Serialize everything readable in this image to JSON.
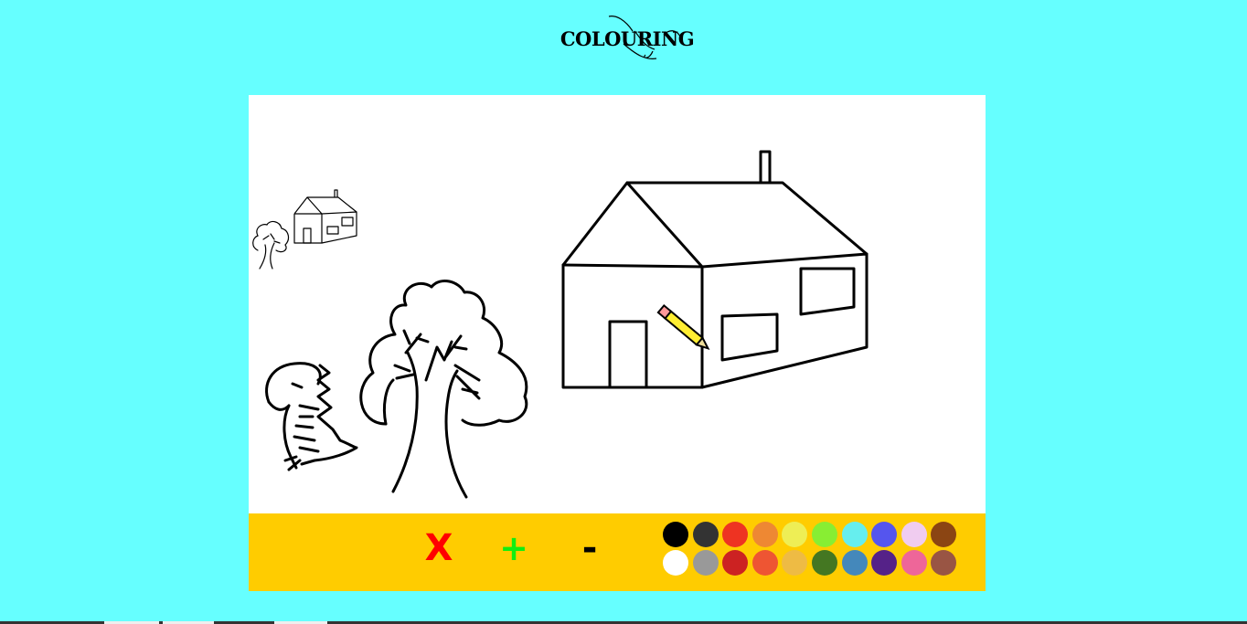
{
  "app": {
    "title": "COLOURING"
  },
  "thumbnails": [
    {
      "name": "tree"
    },
    {
      "name": "house"
    }
  ],
  "toolbar": {
    "clear_label": "X",
    "zoom_in_label": "+",
    "zoom_out_label": "-"
  },
  "palette": {
    "colors": [
      "#000000",
      "#333333",
      "#ee3322",
      "#ee8833",
      "#eeee55",
      "#88ee33",
      "#66eeee",
      "#5555ee",
      "#f0ccf0",
      "#8b4513",
      "#ffffff",
      "#999999",
      "#cc2222",
      "#ee5533",
      "#eebb44",
      "#447722",
      "#4488bb",
      "#552288",
      "#ee6699",
      "#995544"
    ]
  },
  "cursor": {
    "icon": "pencil-icon"
  }
}
